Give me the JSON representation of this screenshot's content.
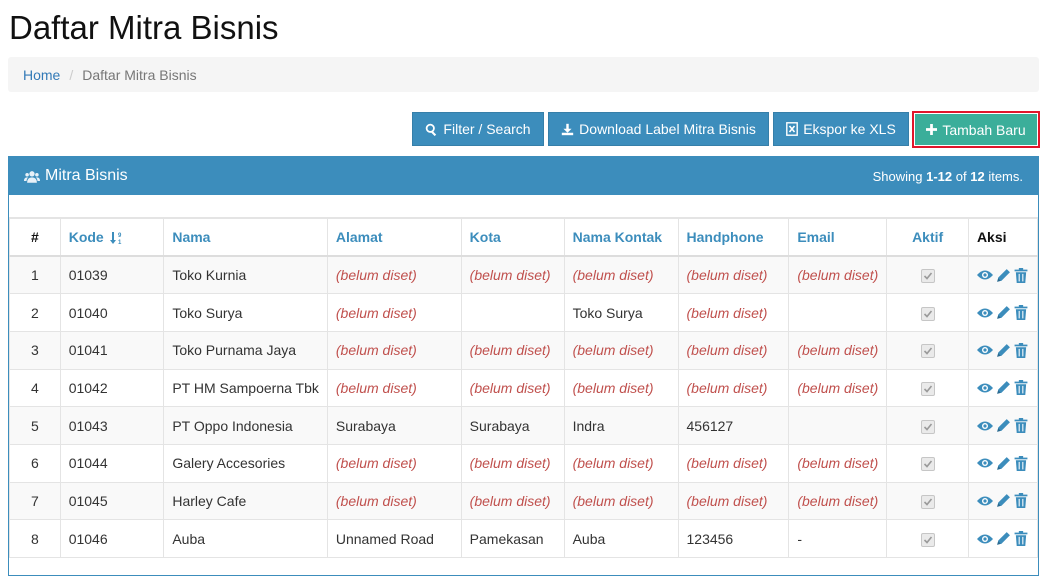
{
  "page": {
    "title": "Daftar Mitra Bisnis"
  },
  "breadcrumb": {
    "home": "Home",
    "separator": "/",
    "current": "Daftar Mitra Bisnis"
  },
  "toolbar": {
    "filter_label": "Filter / Search",
    "download_label": "Download Label Mitra Bisnis",
    "export_label": "Ekspor ke XLS",
    "add_label": "Tambah Baru"
  },
  "panel": {
    "title": "Mitra Bisnis",
    "summary_prefix": "Showing ",
    "summary_range": "1-12",
    "summary_of": " of ",
    "summary_total": "12",
    "summary_suffix": " items."
  },
  "table": {
    "headers": [
      "#",
      "Kode",
      "Nama",
      "Alamat",
      "Kota",
      "Nama Kontak",
      "Handphone",
      "Email",
      "Aktif",
      "Aksi"
    ],
    "unset_text": "(belum diset)",
    "rows": [
      {
        "no": "1",
        "kode": "01039",
        "nama": "Toko Kurnia",
        "alamat": "(belum diset)",
        "kota": "(belum diset)",
        "kontak": "(belum diset)",
        "hp": "(belum diset)",
        "email": "(belum diset)",
        "aktif": true
      },
      {
        "no": "2",
        "kode": "01040",
        "nama": "Toko Surya",
        "alamat": "(belum diset)",
        "kota": "",
        "kontak": "Toko Surya",
        "hp": "(belum diset)",
        "email": "",
        "aktif": true
      },
      {
        "no": "3",
        "kode": "01041",
        "nama": "Toko Purnama Jaya",
        "alamat": "(belum diset)",
        "kota": "(belum diset)",
        "kontak": "(belum diset)",
        "hp": "(belum diset)",
        "email": "(belum diset)",
        "aktif": true
      },
      {
        "no": "4",
        "kode": "01042",
        "nama": "PT HM Sampoerna Tbk",
        "alamat": "(belum diset)",
        "kota": "(belum diset)",
        "kontak": "(belum diset)",
        "hp": "(belum diset)",
        "email": "(belum diset)",
        "aktif": true
      },
      {
        "no": "5",
        "kode": "01043",
        "nama": "PT Oppo Indonesia",
        "alamat": "Surabaya",
        "kota": "Surabaya",
        "kontak": "Indra",
        "hp": "456127",
        "email": "",
        "aktif": true
      },
      {
        "no": "6",
        "kode": "01044",
        "nama": "Galery Accesories",
        "alamat": "(belum diset)",
        "kota": "(belum diset)",
        "kontak": "(belum diset)",
        "hp": "(belum diset)",
        "email": "(belum diset)",
        "aktif": true
      },
      {
        "no": "7",
        "kode": "01045",
        "nama": "Harley Cafe",
        "alamat": "(belum diset)",
        "kota": "(belum diset)",
        "kontak": "(belum diset)",
        "hp": "(belum diset)",
        "email": "(belum diset)",
        "aktif": true
      },
      {
        "no": "8",
        "kode": "01046",
        "nama": "Auba",
        "alamat": "Unnamed Road",
        "kota": "Pamekasan",
        "kontak": "Auba",
        "hp": "123456",
        "email": "-",
        "aktif": true
      }
    ]
  },
  "icons": {
    "filter": "search-icon",
    "download": "download-icon",
    "export": "file-excel-icon",
    "add": "plus-icon",
    "panel": "users-icon",
    "sort": "sort-numeric-icon",
    "view": "eye-icon",
    "edit": "pencil-icon",
    "delete": "trash-icon"
  },
  "colors": {
    "primary": "#3c8dbc",
    "success": "#3bae9a",
    "highlight_border": "#e0162b",
    "unset": "#c0504d"
  }
}
